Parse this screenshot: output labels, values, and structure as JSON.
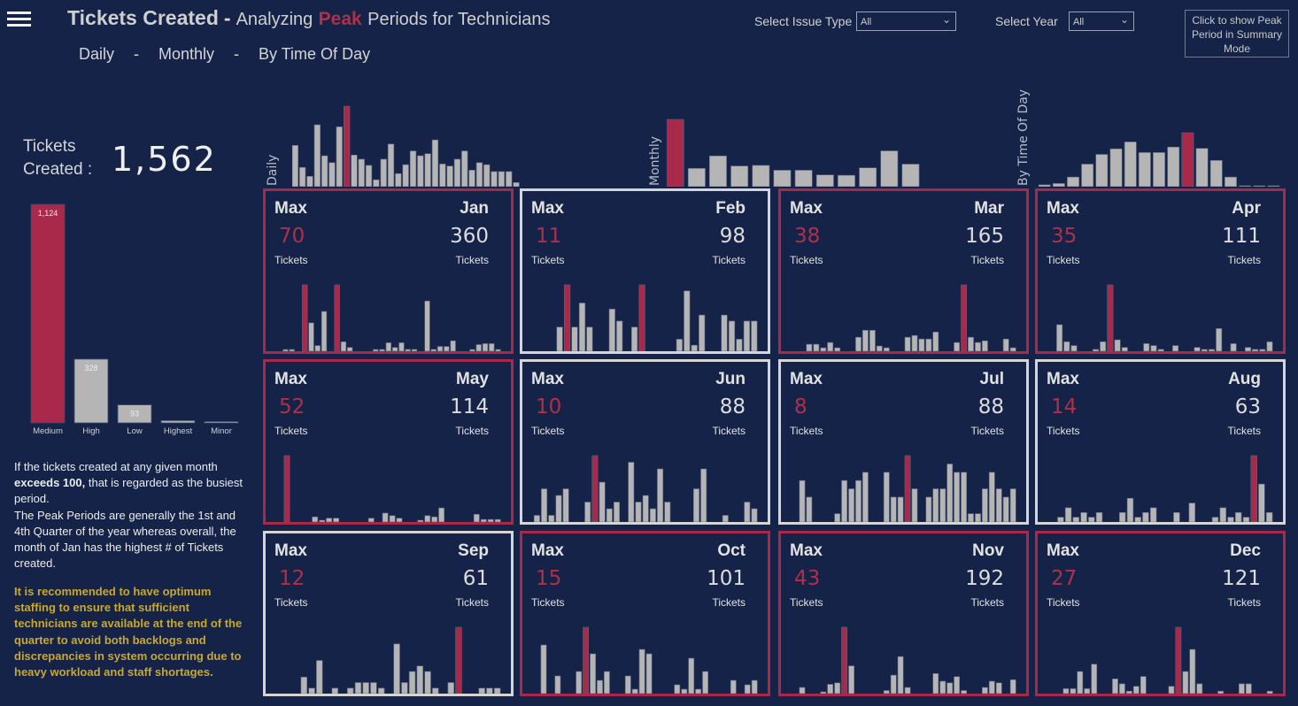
{
  "header": {
    "title_main": "Tickets Created",
    "title_dash": "-",
    "title_pre": "Analyzing",
    "title_peak": "Peak",
    "title_post": "Periods for Technicians",
    "nav": [
      {
        "label": "Daily"
      },
      {
        "label": "Monthly"
      },
      {
        "label": "By Time Of Day"
      }
    ],
    "nav_sep": "-"
  },
  "filters": {
    "issue_type_label": "Select Issue Type",
    "issue_type_value": "All",
    "year_label": "Select Year",
    "year_value": "All",
    "summary_button": "Click to show Peak Period in Summary Mode"
  },
  "kpi": {
    "label_line1": "Tickets",
    "label_line2": "Created :",
    "value": "1,562"
  },
  "colors": {
    "background": "#142347",
    "accent": "#a8294a",
    "bar": "#b5b5b5",
    "recommendation": "#c8a832"
  },
  "notes": {
    "p1_pre": "If the tickets created at any given month ",
    "p1_bold": "exceeds 100,",
    "p1_post": " that is regarded as the busiest period.",
    "p2": "The Peak Periods are generally the 1st and 4th Quarter of the year whereas overall, the month of Jan has the highest # of Tickets created.",
    "recommendation": "It is recommended to have optimum staffing to ensure that sufficient technicians are available at the end of the quarter to avoid both backlogs and discrepancies in system occurring due to heavy workload and staff shortages."
  },
  "card_labels": {
    "max": "Max",
    "tickets": "Tickets"
  },
  "chart_data": [
    {
      "id": "priority",
      "type": "bar",
      "title": "",
      "categories": [
        "Medium",
        "High",
        "Low",
        "Highest",
        "Minor"
      ],
      "values": [
        1124,
        328,
        93,
        12,
        3
      ],
      "labels": [
        "1,124",
        "328",
        "93",
        "",
        ""
      ],
      "highlight": "Medium"
    },
    {
      "id": "daily",
      "type": "bar",
      "ylabel": "Daily",
      "categories": [
        "1",
        "2",
        "3",
        "4",
        "5",
        "6",
        "7",
        "8",
        "9",
        "10",
        "11",
        "12",
        "13",
        "14",
        "15",
        "16",
        "17",
        "18",
        "19",
        "20",
        "21",
        "22",
        "23",
        "24",
        "25",
        "26",
        "27",
        "28",
        "29",
        "30",
        "31"
      ],
      "values": [
        60,
        28,
        15,
        90,
        45,
        35,
        87,
        117,
        46,
        40,
        31,
        10,
        40,
        62,
        19,
        32,
        52,
        45,
        48,
        68,
        33,
        30,
        40,
        52,
        24,
        35,
        32,
        22,
        22,
        22,
        6
      ],
      "highlight": "8"
    },
    {
      "id": "monthly",
      "type": "bar",
      "ylabel": "Monthly",
      "categories": [
        "Jan",
        "Feb",
        "Mar",
        "Apr",
        "May",
        "Jun",
        "Jul",
        "Aug",
        "Sep",
        "Oct",
        "Nov",
        "Dec"
      ],
      "values": [
        360,
        98,
        165,
        111,
        114,
        88,
        88,
        63,
        61,
        101,
        192,
        121
      ],
      "highlight": "Jan"
    },
    {
      "id": "time_of_day",
      "type": "bar",
      "ylabel": "By Time Of Day",
      "categories": [
        "0",
        "1",
        "2",
        "3",
        "4",
        "5",
        "6",
        "7",
        "8",
        "9",
        "10",
        "11",
        "12",
        "13",
        "14",
        "15",
        "16"
      ],
      "values": [
        4,
        7,
        21,
        49,
        70,
        82,
        97,
        74,
        74,
        86,
        117,
        83,
        57,
        21,
        2,
        2,
        2
      ],
      "highlight": "10"
    },
    {
      "id": "months",
      "type": "bar",
      "series": [
        {
          "name": "Jan",
          "total": "360",
          "max": "70",
          "peak": true,
          "values": [
            0,
            0,
            1,
            1,
            0,
            70,
            30,
            6,
            42,
            0,
            70,
            10,
            4,
            0,
            0,
            0,
            1,
            1,
            9,
            4,
            9,
            2,
            2,
            0,
            53,
            2,
            5,
            5,
            11,
            0,
            0,
            1,
            7,
            8,
            8,
            1
          ]
        },
        {
          "name": "Feb",
          "total": "98",
          "max": "11",
          "peak": false,
          "values": [
            0,
            0,
            0,
            0,
            4,
            11,
            4,
            8,
            4,
            0,
            0,
            7,
            5,
            0,
            4,
            11,
            0,
            0,
            0,
            0,
            2,
            10,
            1,
            6,
            0,
            0,
            6,
            5,
            2,
            5,
            5
          ]
        },
        {
          "name": "Mar",
          "total": "165",
          "max": "38",
          "peak": true,
          "values": [
            0,
            0,
            0,
            4,
            4,
            2,
            5,
            2,
            0,
            0,
            8,
            12,
            12,
            3,
            2,
            0,
            0,
            8,
            9,
            7,
            7,
            11,
            0,
            0,
            5,
            38,
            8,
            5,
            6,
            0,
            0,
            7,
            2
          ]
        },
        {
          "name": "Apr",
          "total": "111",
          "max": "35",
          "peak": true,
          "values": [
            0,
            0,
            14,
            5,
            3,
            0,
            0,
            1,
            5,
            35,
            6,
            2,
            0,
            0,
            4,
            3,
            1,
            0,
            3,
            0,
            0,
            2,
            1,
            1,
            12,
            0,
            4,
            0,
            2,
            1,
            1,
            5
          ]
        },
        {
          "name": "May",
          "total": "114",
          "max": "52",
          "peak": true,
          "values": [
            0,
            0,
            52,
            0,
            0,
            0,
            4,
            1,
            3,
            3,
            0,
            0,
            0,
            0,
            3,
            0,
            7,
            5,
            3,
            0,
            0,
            1,
            5,
            4,
            11,
            0,
            0,
            0,
            0,
            6,
            2,
            2,
            2
          ]
        },
        {
          "name": "Jun",
          "total": "88",
          "max": "10",
          "peak": false,
          "values": [
            0,
            1,
            5,
            1,
            4,
            5,
            0,
            0,
            3,
            10,
            6,
            2,
            3,
            0,
            9,
            3,
            4,
            2,
            8,
            3,
            0,
            0,
            0,
            5,
            8,
            0,
            0,
            1,
            0,
            0,
            3,
            2
          ]
        },
        {
          "name": "Jul",
          "total": "88",
          "max": "8",
          "peak": false,
          "values": [
            0,
            0,
            5,
            3,
            0,
            0,
            0,
            1,
            5,
            4,
            5,
            6,
            0,
            0,
            6,
            3,
            3,
            8,
            4,
            0,
            3,
            4,
            4,
            7,
            6,
            6,
            1,
            1,
            4,
            6,
            4,
            3,
            4
          ]
        },
        {
          "name": "Aug",
          "total": "63",
          "max": "14",
          "peak": false,
          "values": [
            0,
            0,
            1,
            3,
            1,
            2,
            1,
            2,
            0,
            0,
            2,
            5,
            1,
            2,
            3,
            0,
            0,
            2,
            0,
            4,
            0,
            0,
            1,
            3,
            1,
            2,
            1,
            14,
            8,
            2
          ]
        },
        {
          "name": "Sep",
          "total": "61",
          "max": "12",
          "peak": false,
          "values": [
            0,
            0,
            0,
            0,
            3,
            1,
            6,
            0,
            1,
            0,
            1,
            2,
            2,
            2,
            1,
            0,
            9,
            2,
            4,
            5,
            4,
            1,
            0,
            2,
            12,
            0,
            0,
            1,
            1,
            1
          ]
        },
        {
          "name": "Oct",
          "total": "101",
          "max": "15",
          "peak": true,
          "values": [
            0,
            0,
            11,
            0,
            4,
            0,
            0,
            5,
            15,
            9,
            3,
            5,
            0,
            0,
            4,
            1,
            10,
            9,
            0,
            0,
            0,
            2,
            1,
            8,
            1,
            5,
            0,
            0,
            0,
            3,
            0,
            2,
            3
          ]
        },
        {
          "name": "Nov",
          "total": "192",
          "max": "43",
          "peak": true,
          "values": [
            0,
            0,
            4,
            0,
            0,
            1,
            6,
            7,
            43,
            18,
            0,
            0,
            0,
            0,
            2,
            12,
            24,
            4,
            0,
            0,
            0,
            13,
            8,
            7,
            11,
            2,
            0,
            0,
            4,
            8,
            7,
            0,
            9
          ]
        },
        {
          "name": "Dec",
          "total": "121",
          "max": "27",
          "peak": true,
          "values": [
            0,
            0,
            0,
            2,
            2,
            9,
            2,
            12,
            0,
            0,
            6,
            4,
            1,
            3,
            7,
            0,
            0,
            0,
            3,
            27,
            9,
            18,
            4,
            0,
            0,
            1,
            0,
            0,
            4,
            4,
            0,
            0,
            1
          ]
        }
      ]
    }
  ]
}
